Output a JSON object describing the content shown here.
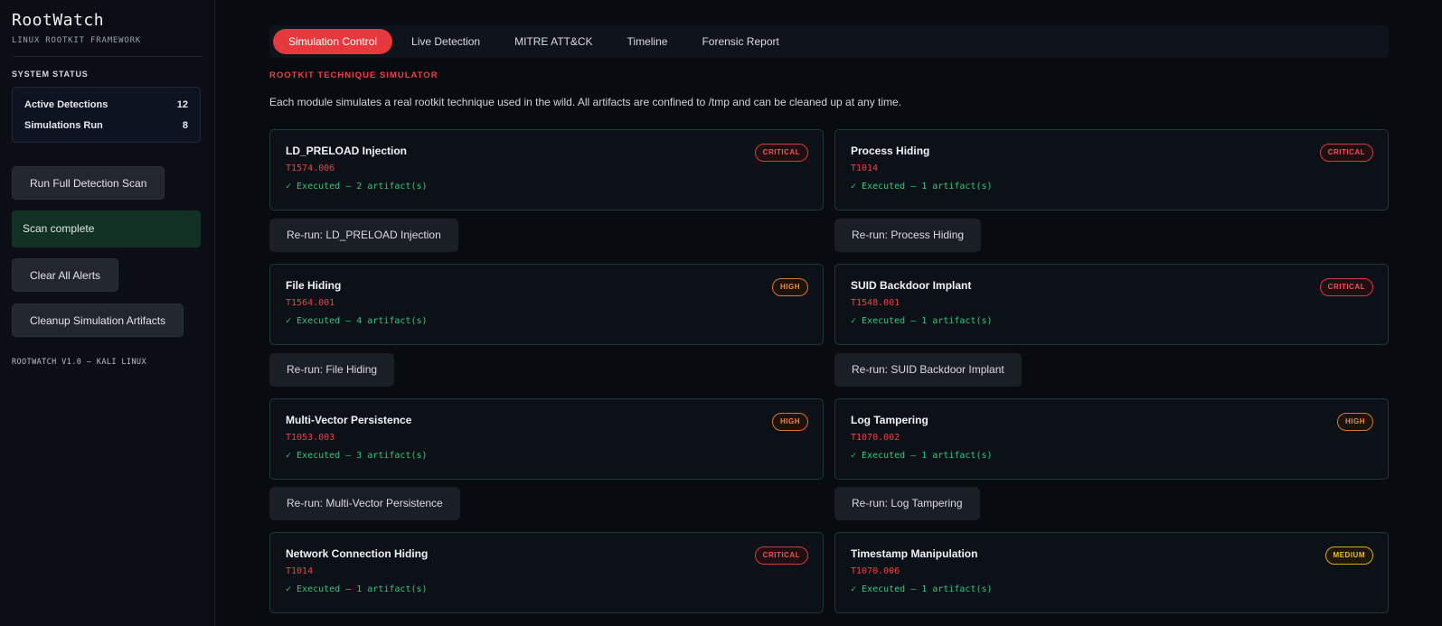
{
  "sidebar": {
    "title": "RootWatch",
    "subtitle": "LINUX ROOTKIT FRAMEWORK",
    "system_status_label": "SYSTEM STATUS",
    "stats": [
      {
        "label": "Active Detections",
        "value": "12"
      },
      {
        "label": "Simulations Run",
        "value": "8"
      }
    ],
    "run_scan_label": "Run Full Detection Scan",
    "scan_status": "Scan complete",
    "clear_alerts_label": "Clear All Alerts",
    "cleanup_label": "Cleanup Simulation Artifacts",
    "version": "ROOTWATCH V1.0 — KALI LINUX"
  },
  "tabs": [
    {
      "label": "Simulation Control",
      "active": true
    },
    {
      "label": "Live Detection",
      "active": false
    },
    {
      "label": "MITRE ATT&CK",
      "active": false
    },
    {
      "label": "Timeline",
      "active": false
    },
    {
      "label": "Forensic Report",
      "active": false
    }
  ],
  "section": {
    "title": "ROOTKIT TECHNIQUE SIMULATOR",
    "description": "Each module simulates a real rootkit technique used in the wild. All artifacts are confined to /tmp and can be cleaned up at any time."
  },
  "modules": [
    {
      "name": "LD_PRELOAD Injection",
      "technique": "T1574.006",
      "status": "✓ Executed — 2 artifact(s)",
      "severity": "CRITICAL",
      "rerun": "Re-run: LD_PRELOAD Injection"
    },
    {
      "name": "Process Hiding",
      "technique": "T1014",
      "status": "✓ Executed — 1 artifact(s)",
      "severity": "CRITICAL",
      "rerun": "Re-run: Process Hiding"
    },
    {
      "name": "File Hiding",
      "technique": "T1564.001",
      "status": "✓ Executed — 4 artifact(s)",
      "severity": "HIGH",
      "rerun": "Re-run: File Hiding"
    },
    {
      "name": "SUID Backdoor Implant",
      "technique": "T1548.001",
      "status": "✓ Executed — 1 artifact(s)",
      "severity": "CRITICAL",
      "rerun": "Re-run: SUID Backdoor Implant"
    },
    {
      "name": "Multi-Vector Persistence",
      "technique": "T1053.003",
      "status": "✓ Executed — 3 artifact(s)",
      "severity": "HIGH",
      "rerun": "Re-run: Multi-Vector Persistence"
    },
    {
      "name": "Log Tampering",
      "technique": "T1070.002",
      "status": "✓ Executed — 1 artifact(s)",
      "severity": "HIGH",
      "rerun": "Re-run: Log Tampering"
    },
    {
      "name": "Network Connection Hiding",
      "technique": "T1014",
      "status": "✓ Executed — 1 artifact(s)",
      "severity": "CRITICAL",
      "rerun": ""
    },
    {
      "name": "Timestamp Manipulation",
      "technique": "T1070.006",
      "status": "✓ Executed — 1 artifact(s)",
      "severity": "MEDIUM",
      "rerun": ""
    }
  ],
  "colors": {
    "accent": "#e5393e",
    "critical": "#f05357",
    "high": "#f08a3a",
    "medium": "#f1bf2f",
    "success": "#34c77b"
  }
}
